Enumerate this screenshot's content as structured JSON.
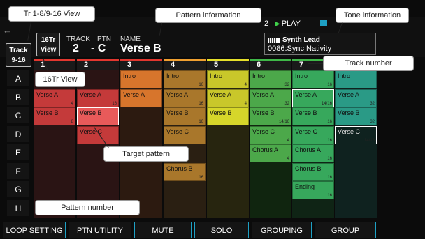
{
  "header": {
    "view_16tr_label": "16Tr View",
    "view_tr_label": "Track 9-16",
    "track_label": "TRACK",
    "ptn_label": "PTN",
    "name_label": "NAME",
    "track_value": "2",
    "ptn_value": "- C",
    "name_value": "Verse B",
    "play_count": "2",
    "play_state": "PLAY",
    "tone_name": "Synth Lead",
    "tone_number": "0086:Sync Nativity"
  },
  "tracks": [
    {
      "num": "1",
      "color": "#e2372f"
    },
    {
      "num": "2",
      "color": "#e2372f"
    },
    {
      "num": "3",
      "color": "#e2372f"
    },
    {
      "num": "4",
      "color": "#f0a030"
    },
    {
      "num": "5",
      "color": "#e6e02a"
    },
    {
      "num": "6",
      "color": "#3fb848"
    },
    {
      "num": "7",
      "color": "#3fb848"
    },
    {
      "num": "8",
      "color": "#26b090"
    }
  ],
  "rows": [
    "A",
    "B",
    "C",
    "D",
    "E",
    "F",
    "G",
    "H"
  ],
  "patterns": {
    "t1": [
      {
        "row": 1,
        "name": "Verse A",
        "len": "4"
      },
      {
        "row": 2,
        "name": "Verse B",
        "len": "8"
      }
    ],
    "t2": [
      {
        "row": 1,
        "name": "Verse A",
        "len": "16"
      },
      {
        "row": 2,
        "name": "Verse B",
        "len": ""
      },
      {
        "row": 3,
        "name": "Verse C",
        "len": ""
      }
    ],
    "t3": [
      {
        "row": 0,
        "name": "Intro",
        "len": ""
      },
      {
        "row": 1,
        "name": "Verse A",
        "len": ""
      }
    ],
    "t4": [
      {
        "row": 0,
        "name": "Intro",
        "len": "16"
      },
      {
        "row": 1,
        "name": "Verse A",
        "len": "16"
      },
      {
        "row": 2,
        "name": "Verse B",
        "len": "16"
      },
      {
        "row": 3,
        "name": "Verse C",
        "len": ""
      },
      {
        "row": 5,
        "name": "Chorus B",
        "len": "16"
      }
    ],
    "t5": [
      {
        "row": 0,
        "name": "Intro",
        "len": "4"
      },
      {
        "row": 1,
        "name": "Verse A",
        "len": "4"
      },
      {
        "row": 2,
        "name": "Verse B",
        "len": ""
      }
    ],
    "t6": [
      {
        "row": 0,
        "name": "Intro",
        "len": "32"
      },
      {
        "row": 1,
        "name": "Verse A",
        "len": "32"
      },
      {
        "row": 2,
        "name": "Verse B",
        "len": "14/16"
      },
      {
        "row": 3,
        "name": "Verse C",
        "len": "4"
      },
      {
        "row": 4,
        "name": "Chorus A",
        "len": "4"
      }
    ],
    "t7": [
      {
        "row": 0,
        "name": "Intro",
        "len": "16"
      },
      {
        "row": 1,
        "name": "Verse A",
        "len": "14/16"
      },
      {
        "row": 2,
        "name": "Verse B",
        "len": "16"
      },
      {
        "row": 3,
        "name": "Verse C",
        "len": "16"
      },
      {
        "row": 4,
        "name": "Chorus A",
        "len": "16"
      },
      {
        "row": 5,
        "name": "Chorus B",
        "len": "16"
      },
      {
        "row": 6,
        "name": "Ending",
        "len": "16"
      }
    ],
    "t8": [
      {
        "row": 0,
        "name": "Intro",
        "len": ""
      },
      {
        "row": 1,
        "name": "Verse A",
        "len": "32"
      },
      {
        "row": 2,
        "name": "Verse B",
        "len": "32"
      },
      {
        "row": 3,
        "name": "Verse C",
        "len": "14/16"
      }
    ]
  },
  "menu": [
    "LOOP SETTING",
    "PTN UTILITY",
    "MUTE",
    "SOLO",
    "GROUPING",
    "GROUP"
  ],
  "callouts": {
    "tr_view": "Tr 1-8/9-16 View",
    "pattern_info": "Pattern information",
    "tone_info": "Tone information",
    "track_number": "Track number",
    "view_16tr": "16Tr View",
    "target_pattern": "Target pattern",
    "pattern_number": "Pattern number"
  }
}
